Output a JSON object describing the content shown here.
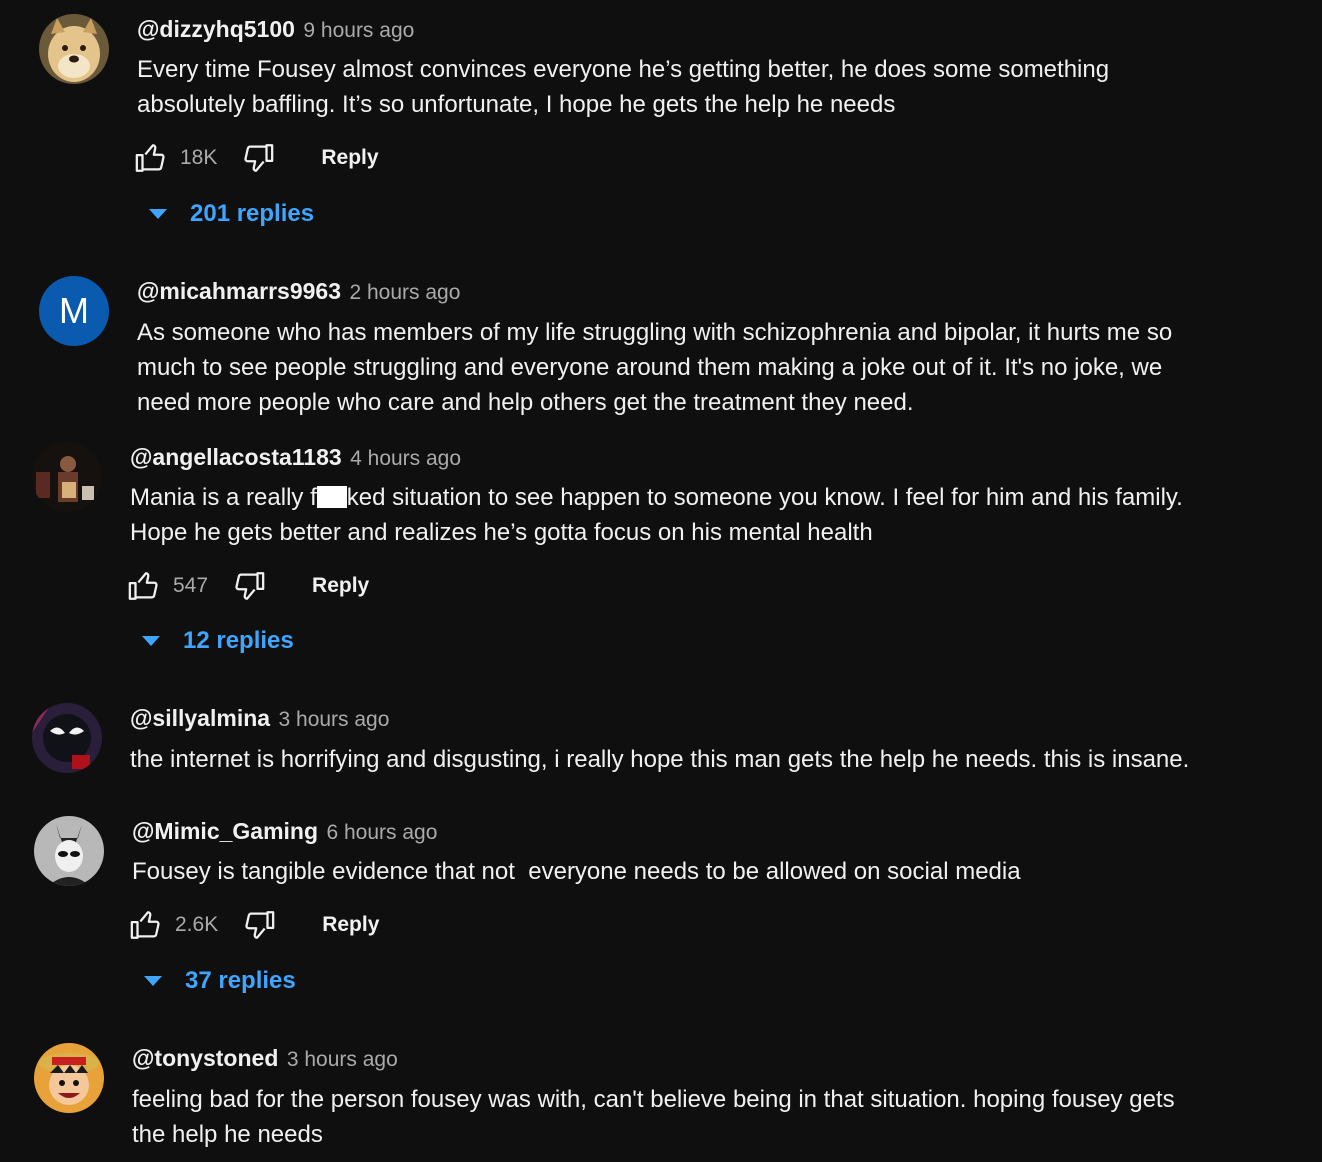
{
  "colors": {
    "background": "#0f0f0f",
    "text": "#f1f1f1",
    "muted": "#aaaaaa",
    "link": "#3ea6ff",
    "avatar_m": "#0a5ab0"
  },
  "comments": [
    {
      "handle": "@dizzyhq5100",
      "time": "9 hours ago",
      "lines": [
        "Every time Fousey almost convinces everyone he’s getting better, he does some something",
        "absolutely baffling. It’s so unfortunate, I hope he gets the help he needs"
      ],
      "likes": "18K",
      "reply_label": "Reply",
      "replies_label": "201 replies",
      "avatar_icon": "doge-avatar"
    },
    {
      "handle": "@micahmarrs9963",
      "time": "2 hours ago",
      "lines": [
        "As someone who has members of my life struggling with schizophrenia and bipolar, it hurts me so",
        "much to see people struggling and everyone around them making a joke out of it. It's no joke, we",
        "need more people who care and help others get the treatment they need."
      ],
      "avatar_letter": "M"
    },
    {
      "handle": "@angellacosta1183",
      "time": "4 hours ago",
      "line1_before": "Mania is a really f",
      "line1_after": "ked situation to see happen to someone you know. I feel for him and his family.",
      "line2": "Hope he gets better and realizes he’s gotta focus on his mental health",
      "likes": "547",
      "reply_label": "Reply",
      "replies_label": "12 replies",
      "avatar_icon": "photo-avatar"
    },
    {
      "handle": "@sillyalmina",
      "time": "3 hours ago",
      "lines": [
        "the internet is horrifying and disgusting, i really hope this man gets the help he needs. this is insane."
      ],
      "avatar_icon": "spider-avatar"
    },
    {
      "handle": "@Mimic_Gaming",
      "time": "6 hours ago",
      "lines": [
        "Fousey is tangible evidence that not  everyone needs to be allowed on social media"
      ],
      "likes": "2.6K",
      "reply_label": "Reply",
      "replies_label": "37 replies",
      "avatar_icon": "mask-avatar"
    },
    {
      "handle": "@tonystoned",
      "time": "3 hours ago",
      "lines": [
        "feeling bad for the person fousey was with, can't believe being in that situation. hoping fousey gets",
        "the help he needs"
      ],
      "avatar_icon": "luffy-avatar"
    }
  ]
}
